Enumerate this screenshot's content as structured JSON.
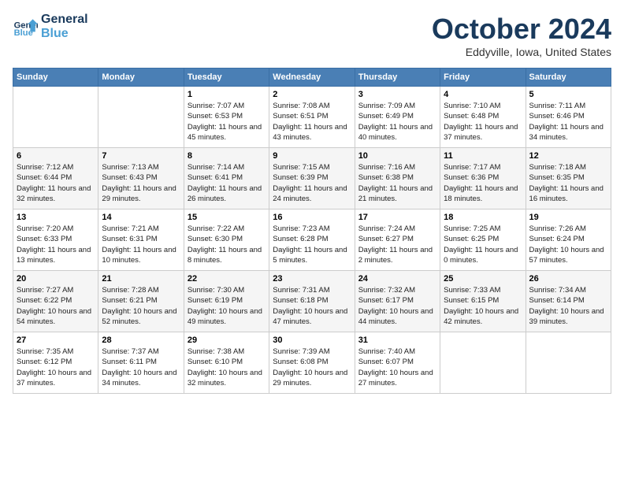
{
  "header": {
    "logo_line1": "General",
    "logo_line2": "Blue",
    "month_title": "October 2024",
    "location": "Eddyville, Iowa, United States"
  },
  "weekdays": [
    "Sunday",
    "Monday",
    "Tuesday",
    "Wednesday",
    "Thursday",
    "Friday",
    "Saturday"
  ],
  "weeks": [
    [
      null,
      null,
      {
        "day": "1",
        "sunrise": "7:07 AM",
        "sunset": "6:53 PM",
        "daylight": "11 hours and 45 minutes."
      },
      {
        "day": "2",
        "sunrise": "7:08 AM",
        "sunset": "6:51 PM",
        "daylight": "11 hours and 43 minutes."
      },
      {
        "day": "3",
        "sunrise": "7:09 AM",
        "sunset": "6:49 PM",
        "daylight": "11 hours and 40 minutes."
      },
      {
        "day": "4",
        "sunrise": "7:10 AM",
        "sunset": "6:48 PM",
        "daylight": "11 hours and 37 minutes."
      },
      {
        "day": "5",
        "sunrise": "7:11 AM",
        "sunset": "6:46 PM",
        "daylight": "11 hours and 34 minutes."
      }
    ],
    [
      {
        "day": "6",
        "sunrise": "7:12 AM",
        "sunset": "6:44 PM",
        "daylight": "11 hours and 32 minutes."
      },
      {
        "day": "7",
        "sunrise": "7:13 AM",
        "sunset": "6:43 PM",
        "daylight": "11 hours and 29 minutes."
      },
      {
        "day": "8",
        "sunrise": "7:14 AM",
        "sunset": "6:41 PM",
        "daylight": "11 hours and 26 minutes."
      },
      {
        "day": "9",
        "sunrise": "7:15 AM",
        "sunset": "6:39 PM",
        "daylight": "11 hours and 24 minutes."
      },
      {
        "day": "10",
        "sunrise": "7:16 AM",
        "sunset": "6:38 PM",
        "daylight": "11 hours and 21 minutes."
      },
      {
        "day": "11",
        "sunrise": "7:17 AM",
        "sunset": "6:36 PM",
        "daylight": "11 hours and 18 minutes."
      },
      {
        "day": "12",
        "sunrise": "7:18 AM",
        "sunset": "6:35 PM",
        "daylight": "11 hours and 16 minutes."
      }
    ],
    [
      {
        "day": "13",
        "sunrise": "7:20 AM",
        "sunset": "6:33 PM",
        "daylight": "11 hours and 13 minutes."
      },
      {
        "day": "14",
        "sunrise": "7:21 AM",
        "sunset": "6:31 PM",
        "daylight": "11 hours and 10 minutes."
      },
      {
        "day": "15",
        "sunrise": "7:22 AM",
        "sunset": "6:30 PM",
        "daylight": "11 hours and 8 minutes."
      },
      {
        "day": "16",
        "sunrise": "7:23 AM",
        "sunset": "6:28 PM",
        "daylight": "11 hours and 5 minutes."
      },
      {
        "day": "17",
        "sunrise": "7:24 AM",
        "sunset": "6:27 PM",
        "daylight": "11 hours and 2 minutes."
      },
      {
        "day": "18",
        "sunrise": "7:25 AM",
        "sunset": "6:25 PM",
        "daylight": "11 hours and 0 minutes."
      },
      {
        "day": "19",
        "sunrise": "7:26 AM",
        "sunset": "6:24 PM",
        "daylight": "10 hours and 57 minutes."
      }
    ],
    [
      {
        "day": "20",
        "sunrise": "7:27 AM",
        "sunset": "6:22 PM",
        "daylight": "10 hours and 54 minutes."
      },
      {
        "day": "21",
        "sunrise": "7:28 AM",
        "sunset": "6:21 PM",
        "daylight": "10 hours and 52 minutes."
      },
      {
        "day": "22",
        "sunrise": "7:30 AM",
        "sunset": "6:19 PM",
        "daylight": "10 hours and 49 minutes."
      },
      {
        "day": "23",
        "sunrise": "7:31 AM",
        "sunset": "6:18 PM",
        "daylight": "10 hours and 47 minutes."
      },
      {
        "day": "24",
        "sunrise": "7:32 AM",
        "sunset": "6:17 PM",
        "daylight": "10 hours and 44 minutes."
      },
      {
        "day": "25",
        "sunrise": "7:33 AM",
        "sunset": "6:15 PM",
        "daylight": "10 hours and 42 minutes."
      },
      {
        "day": "26",
        "sunrise": "7:34 AM",
        "sunset": "6:14 PM",
        "daylight": "10 hours and 39 minutes."
      }
    ],
    [
      {
        "day": "27",
        "sunrise": "7:35 AM",
        "sunset": "6:12 PM",
        "daylight": "10 hours and 37 minutes."
      },
      {
        "day": "28",
        "sunrise": "7:37 AM",
        "sunset": "6:11 PM",
        "daylight": "10 hours and 34 minutes."
      },
      {
        "day": "29",
        "sunrise": "7:38 AM",
        "sunset": "6:10 PM",
        "daylight": "10 hours and 32 minutes."
      },
      {
        "day": "30",
        "sunrise": "7:39 AM",
        "sunset": "6:08 PM",
        "daylight": "10 hours and 29 minutes."
      },
      {
        "day": "31",
        "sunrise": "7:40 AM",
        "sunset": "6:07 PM",
        "daylight": "10 hours and 27 minutes."
      },
      null,
      null
    ]
  ]
}
